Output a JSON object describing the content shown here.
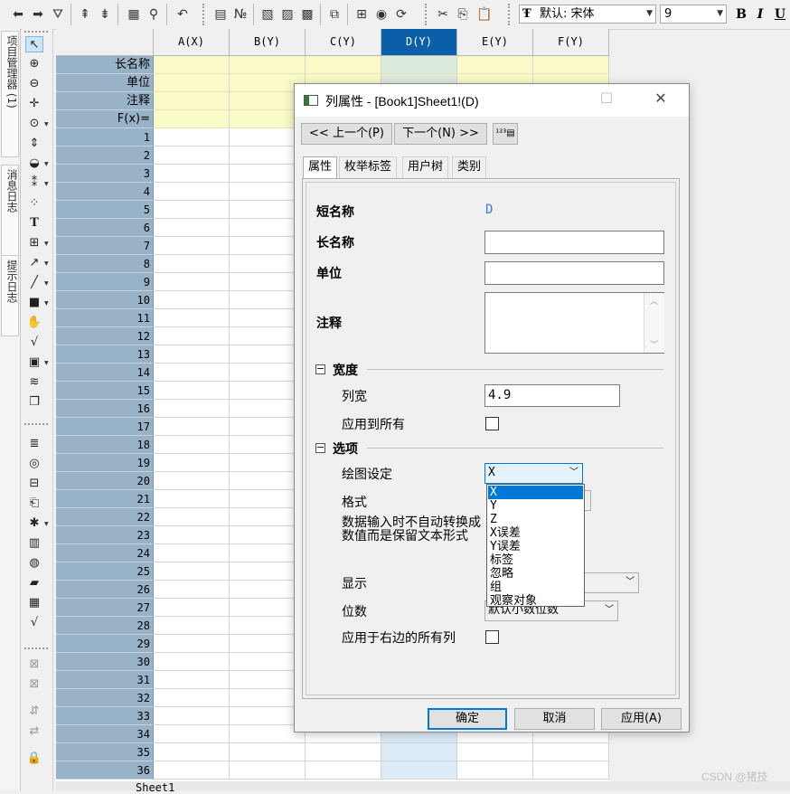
{
  "toolbar": {
    "font_label": "默认: 宋体",
    "font_size": "9",
    "bold_label": "B",
    "italic_label": "I",
    "underline_label": "U"
  },
  "left_tabs": [
    "项目管理器 (1)",
    "消息日志",
    "提示日志"
  ],
  "worksheet": {
    "columns": [
      "A(X)",
      "B(Y)",
      "C(Y)",
      "D(Y)",
      "E(Y)",
      "F(Y)"
    ],
    "selected_column": "D(Y)",
    "meta_rows": [
      "长名称",
      "单位",
      "注释",
      "F(x)="
    ],
    "rows": [
      "1",
      "2",
      "3",
      "4",
      "5",
      "6",
      "7",
      "8",
      "9",
      "10",
      "11",
      "12",
      "13",
      "14",
      "15",
      "16",
      "17",
      "18",
      "19",
      "20",
      "21",
      "22",
      "23",
      "24",
      "25",
      "26",
      "27",
      "28",
      "29",
      "30",
      "31",
      "32",
      "33",
      "34",
      "35",
      "36"
    ],
    "sheet_tab": "Sheet1"
  },
  "dialog": {
    "title": "列属性 - [Book1]Sheet1!(D)",
    "prev_label": "<< 上一个(P)",
    "next_label": "下一个(N) >>",
    "tabs": [
      "属性",
      "枚举标签",
      "用户树",
      "类别"
    ],
    "active_tab": "属性",
    "short_name_label": "短名称",
    "short_name_value": "D",
    "long_name_label": "长名称",
    "long_name_value": "",
    "unit_label": "单位",
    "unit_value": "",
    "comment_label": "注释",
    "comment_value": "",
    "width_section": "宽度",
    "col_width_label": "列宽",
    "col_width_value": "4.9",
    "apply_all_label": "应用到所有",
    "options_section": "选项",
    "plot_label": "绘图设定",
    "plot_value": "X",
    "plot_options": [
      "X",
      "Y",
      "Z",
      "X误差",
      "Y误差",
      "标签",
      "忽略",
      "组",
      "观察对象"
    ],
    "format_label": "格式",
    "keep_text_label": "数据输入时不自动转换成数值而是保留文本形式",
    "display_label": "显示",
    "digits_label": "位数",
    "digits_value": "默认小数位数",
    "apply_right_label": "应用于右边的所有列",
    "ok_label": "确定",
    "cancel_label": "取消",
    "apply_label": "应用(A)"
  },
  "watermark": "CSDN @猪技",
  "colors": {
    "selected_header": "#0a5fa8",
    "row_header": "#98b2c8",
    "meta_fill": "#fafac8",
    "accent": "#0078d7"
  }
}
